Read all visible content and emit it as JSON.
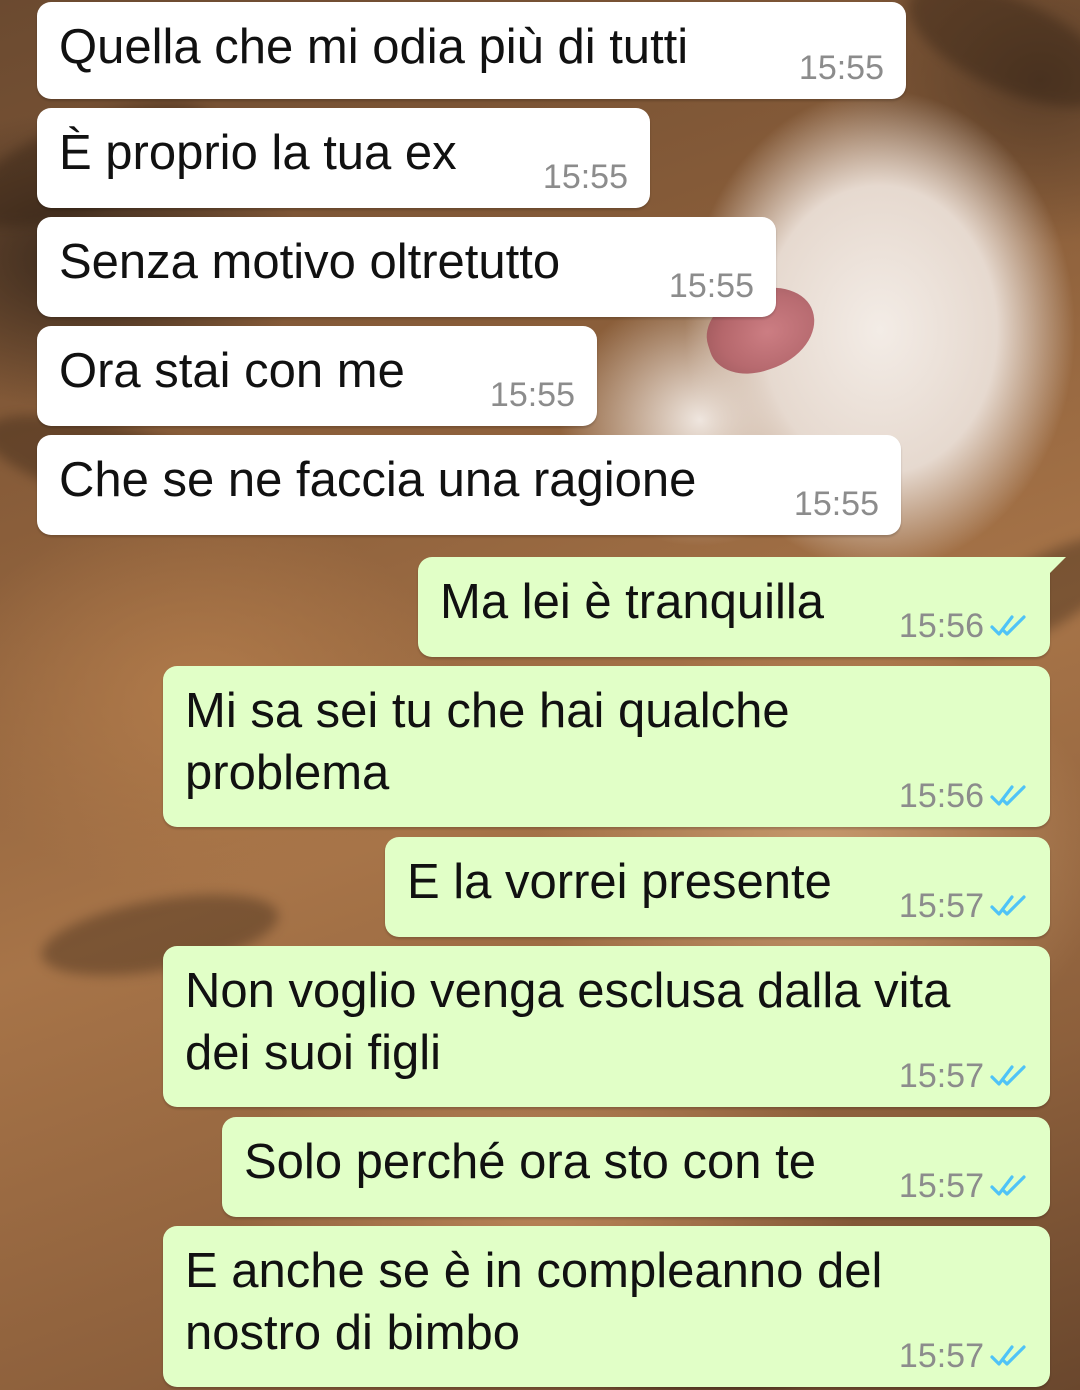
{
  "chat": {
    "messages": [
      {
        "direction": "incoming",
        "text": "Quella che mi odia più di tutti",
        "time": "15:55"
      },
      {
        "direction": "incoming",
        "text": "È proprio la tua ex",
        "time": "15:55"
      },
      {
        "direction": "incoming",
        "text": "Senza motivo oltretutto",
        "time": "15:55"
      },
      {
        "direction": "incoming",
        "text": "Ora stai con me",
        "time": "15:55"
      },
      {
        "direction": "incoming",
        "text": "Che se ne faccia una ragione",
        "time": "15:55"
      },
      {
        "direction": "outgoing",
        "text": "Ma lei è tranquilla",
        "time": "15:56",
        "status": "read"
      },
      {
        "direction": "outgoing",
        "text_line1": "Mi sa sei tu che hai qualche",
        "text_line2": "problema",
        "time": "15:56",
        "status": "read"
      },
      {
        "direction": "outgoing",
        "text": "E la vorrei presente",
        "time": "15:57",
        "status": "read"
      },
      {
        "direction": "outgoing",
        "text_line1": "Non voglio venga esclusa dalla vita",
        "text_line2": "dei suoi figli",
        "time": "15:57",
        "status": "read"
      },
      {
        "direction": "outgoing",
        "text": "Solo perché ora sto con te",
        "time": "15:57",
        "status": "read"
      },
      {
        "direction": "outgoing",
        "text_line1": "E anche se è in compleanno del",
        "text_line2": "nostro di bimbo",
        "time": "15:57",
        "status": "read"
      }
    ]
  },
  "colors": {
    "incoming_bubble": "#ffffff",
    "outgoing_bubble": "#e1ffc7",
    "timestamp": "#8c8c8c",
    "read_ticks": "#4fc3f7"
  },
  "icons": {
    "read_receipt": "double-check-icon"
  }
}
